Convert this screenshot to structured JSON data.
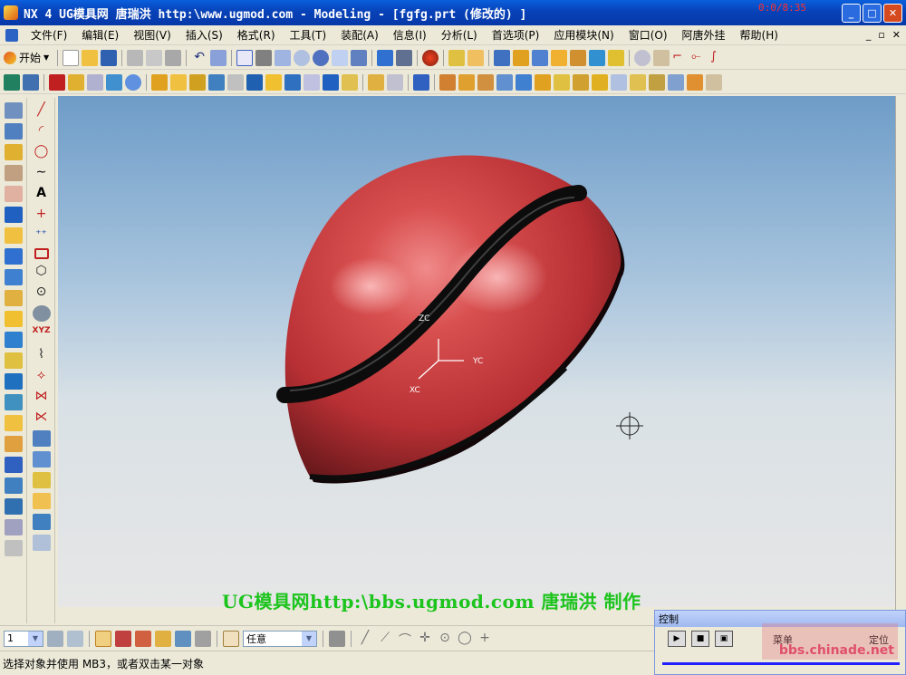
{
  "window": {
    "title": "NX 4 UG模具网  唐瑞洪  http:\\www.ugmod.com - Modeling - [fgfg.prt  (修改的) ]",
    "clock": "0:0/8:35"
  },
  "menu": {
    "items": [
      "文件(F)",
      "编辑(E)",
      "视图(V)",
      "插入(S)",
      "格式(R)",
      "工具(T)",
      "装配(A)",
      "信息(I)",
      "分析(L)",
      "首选项(P)",
      "应用模块(N)",
      "窗口(O)",
      "阿唐外挂",
      "帮助(H)"
    ]
  },
  "toolbar": {
    "start_label": "开始"
  },
  "viewport": {
    "axis": {
      "zc": "ZC",
      "yc": "YC",
      "xc": "XC"
    },
    "watermark": "UG模具网http:\\bbs.ugmod.com 唐瑞洪 制作"
  },
  "bottom": {
    "layer_value": "1",
    "filter_value": "任意"
  },
  "status": {
    "prompt": "选择对象并使用 MB3，或者双击某一对象"
  },
  "control": {
    "title": "控制",
    "menu_label": "菜单",
    "locate_label": "定位",
    "logo_text": "bbs.chinade.net"
  },
  "colors": {
    "title_bar": "#0842b8",
    "part_red": "#c8363a",
    "watermark_green": "#1cc41c"
  }
}
